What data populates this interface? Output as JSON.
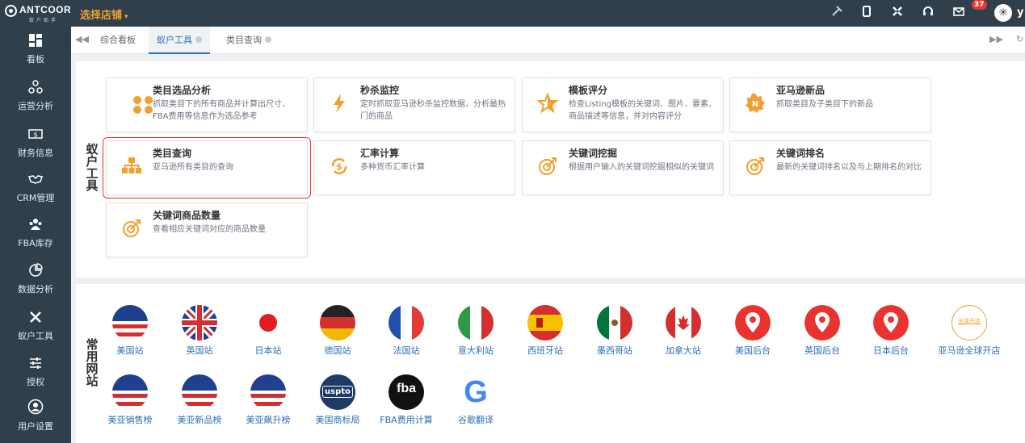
{
  "header": {
    "logo_text": "ANTCOOR",
    "logo_sub": "蚁户助手",
    "store_select": "选择店铺",
    "notification_count": "37",
    "username": "y",
    "icons": [
      "plug-icon",
      "tablet-icon",
      "fullscreen-icon",
      "headset-icon",
      "mail-icon",
      "avatar-icon"
    ]
  },
  "sidebar": {
    "items": [
      {
        "label": "看板",
        "icon": "dashboard-icon"
      },
      {
        "label": "运营分析",
        "icon": "network-icon"
      },
      {
        "label": "财务信息",
        "icon": "money-icon"
      },
      {
        "label": "CRM管理",
        "icon": "handshake-icon"
      },
      {
        "label": "FBA库存",
        "icon": "users-icon"
      },
      {
        "label": "数据分析",
        "icon": "pie-chart-icon"
      },
      {
        "label": "蚁户工具",
        "icon": "tools-icon"
      },
      {
        "label": "授权",
        "icon": "sliders-icon"
      },
      {
        "label": "用户设置",
        "icon": "user-icon"
      }
    ]
  },
  "tabs": [
    {
      "label": "综合看板",
      "closable": false,
      "active": false
    },
    {
      "label": "蚁户工具",
      "closable": true,
      "active": true
    },
    {
      "label": "类目查询",
      "closable": true,
      "active": false
    }
  ],
  "tools": {
    "section_title": [
      "蚁",
      "户",
      "工",
      "具"
    ],
    "cards": [
      {
        "title": "类目选品分析",
        "desc": "抓取类目下的所有商品并计算出尺寸、FBA费用等信息作为选品参考",
        "icon": "dots-icon"
      },
      {
        "title": "秒杀监控",
        "desc": "定时抓取亚马逊秒杀监控数据，分析最热门的商品",
        "icon": "lightning-icon"
      },
      {
        "title": "模板评分",
        "desc": "检查Listing模板的关键词、图片、要素、商品描述等信息，并对内容评分",
        "icon": "star-icon"
      },
      {
        "title": "亚马逊新品",
        "desc": "抓取类目及子类目下的新品",
        "icon": "new-badge-icon"
      },
      {
        "title": "类目查询",
        "desc": "亚马逊所有类目的查询",
        "icon": "sitemap-icon",
        "selected": true
      },
      {
        "title": "汇率计算",
        "desc": "多种货币汇率计算",
        "icon": "currency-icon"
      },
      {
        "title": "关键词挖掘",
        "desc": "根据用户输入的关键词挖掘相似的关键词",
        "icon": "target-icon"
      },
      {
        "title": "关键词排名",
        "desc": "最新的关键词排名以及与上期排名的对比",
        "icon": "target-icon"
      },
      {
        "title": "关键词商品数量",
        "desc": "查看相应关键词对应的商品数量",
        "icon": "target-icon"
      }
    ]
  },
  "sites": {
    "section_title": [
      "常",
      "用",
      "网",
      "站"
    ],
    "row1": [
      {
        "label": "美国站",
        "icon": "us-flag-icon"
      },
      {
        "label": "英国站",
        "icon": "uk-flag-icon"
      },
      {
        "label": "日本站",
        "icon": "jp-flag-icon"
      },
      {
        "label": "德国站",
        "icon": "de-flag-icon"
      },
      {
        "label": "法国站",
        "icon": "fr-flag-icon"
      },
      {
        "label": "意大利站",
        "icon": "it-flag-icon"
      },
      {
        "label": "西班牙站",
        "icon": "es-flag-icon"
      },
      {
        "label": "墨西哥站",
        "icon": "mx-flag-icon"
      },
      {
        "label": "加拿大站",
        "icon": "ca-flag-icon"
      },
      {
        "label": "美国后台",
        "icon": "location-pin-icon"
      },
      {
        "label": "英国后台",
        "icon": "location-pin-icon"
      },
      {
        "label": "日本后台",
        "icon": "location-pin-icon"
      },
      {
        "label": "亚马逊全球开店",
        "icon": "global-selling-icon",
        "logo_text": "全球开店"
      }
    ],
    "row2": [
      {
        "label": "美亚销售榜",
        "icon": "us-flag-icon"
      },
      {
        "label": "美亚新品榜",
        "icon": "us-flag-icon"
      },
      {
        "label": "美亚飙升榜",
        "icon": "us-flag-icon"
      },
      {
        "label": "美国商标局",
        "icon": "uspto-icon",
        "logo_text": "uspto"
      },
      {
        "label": "FBA费用计算",
        "icon": "fba-icon",
        "logo_text": "fba"
      },
      {
        "label": "谷歌翻译",
        "icon": "google-icon",
        "logo_text": "G"
      }
    ]
  },
  "colors": {
    "accent": "#f0a030",
    "nav": "#2f3f4c",
    "link": "#2b6fb3",
    "selected_outline": "#e0332f"
  }
}
